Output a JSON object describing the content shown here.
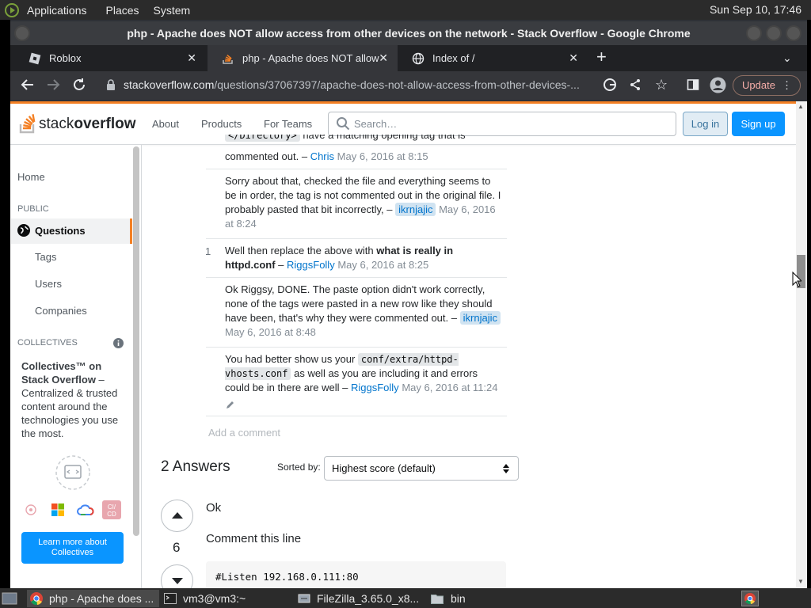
{
  "panel": {
    "menus": [
      "Applications",
      "Places",
      "System"
    ],
    "clock": "Sun Sep 10, 17:46"
  },
  "window": {
    "title": "php - Apache does NOT allow access from other devices on the network - Stack Overflow - Google Chrome"
  },
  "tabs": [
    {
      "label": "Roblox",
      "close": "✕"
    },
    {
      "label": "php - Apache does NOT allow",
      "close": "✕"
    },
    {
      "label": "Index of /",
      "close": "✕"
    }
  ],
  "toolbar": {
    "url_host": "stackoverflow.com",
    "url_path": "/questions/37067397/apache-does-not-allow-access-from-other-devices-...",
    "update_label": "Update"
  },
  "so_header": {
    "logo_text_a": "stack",
    "logo_text_b": "overflow",
    "nav": [
      "About",
      "Products",
      "For Teams"
    ],
    "search_placeholder": "Search…",
    "login": "Log in",
    "signup": "Sign up"
  },
  "sidebar": {
    "home": "Home",
    "public_heading": "PUBLIC",
    "questions": "Questions",
    "tags": "Tags",
    "users": "Users",
    "companies": "Companies",
    "collectives_heading": "COLLECTIVES",
    "collectives_title": "Collectives™ on Stack Overflow",
    "collectives_body": " – Centralized & trusted content around the technologies you use the most.",
    "learn_more": "Learn more about Collectives"
  },
  "comments": [
    {
      "text_top_cut": "</Directory>",
      "text_top_rest": " have a matching opening tag that is",
      "text": "commented out. –",
      "user": "Chris",
      "time": "May 6, 2016 at 8:15"
    },
    {
      "text": "Sorry about that, checked the file and everything seems to be in order, the tag is not commented out in the original file. I probably pasted that bit incorrectly, –",
      "user": "ikrnjajic",
      "time": "May 6, 2016 at 8:24"
    },
    {
      "score": "1",
      "text_a": "Well then replace the above with ",
      "text_bold": "what is really in httpd.conf",
      "text_b": " –",
      "user": "RiggsFolly",
      "time": "May 6, 2016 at 8:25"
    },
    {
      "text": "Ok Riggsy, DONE. The paste option didn't work correctly, none of the tags were pasted in a new row like they should have been, that's why they were commented out.",
      "dash": "–",
      "user": "ikrnjajic",
      "time": "May 6, 2016 at 8:48"
    },
    {
      "text_a": "You had better show us your ",
      "code_a": "conf/extra/httpd-vhosts.conf",
      "text_b": " as well as you are including it and errors could be in there are well –",
      "user": "RiggsFolly",
      "time": "May 6, 2016 at 11:24"
    }
  ],
  "add_comment": "Add a comment",
  "answers": {
    "title": "2 Answers",
    "sort_label": "Sorted by:",
    "sort_value": "Highest score (default)",
    "first": {
      "score": "6",
      "line1": "Ok",
      "line2": "Comment this line",
      "code": "#Listen 192.168.0.111:80"
    }
  },
  "taskbar": [
    {
      "label": "php - Apache does ..."
    },
    {
      "label": "vm3@vm3:~"
    },
    {
      "label": "FileZilla_3.65.0_x8..."
    },
    {
      "label": "bin"
    }
  ],
  "colors": {
    "so_orange": "#f48024",
    "so_blue": "#0a95ff",
    "link_blue": "#0074cc"
  }
}
